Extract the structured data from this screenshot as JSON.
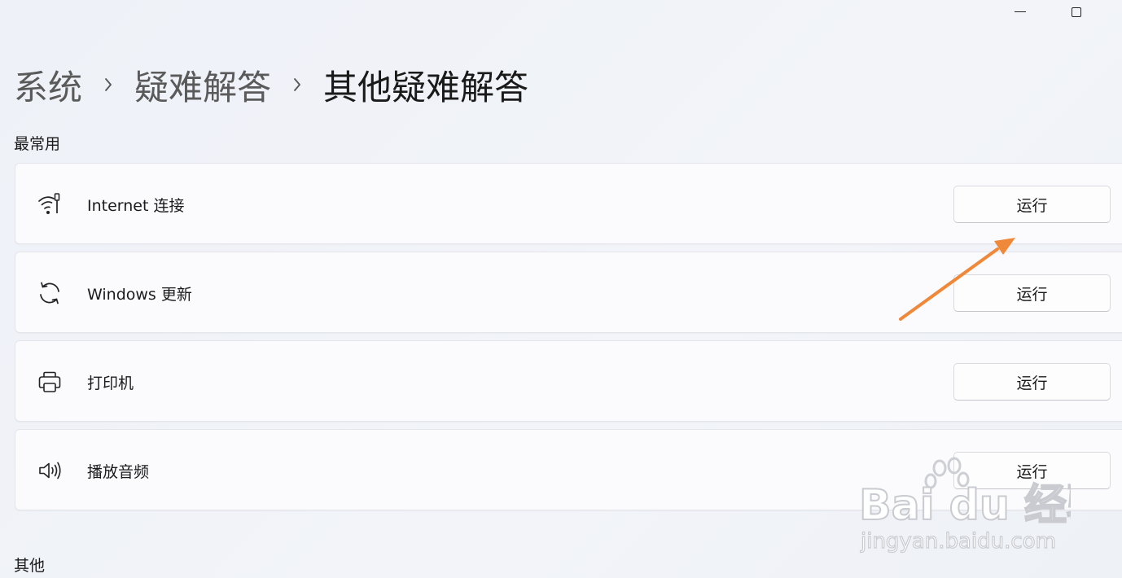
{
  "window": {
    "minimize_icon": "minimize-icon",
    "maximize_icon": "maximize-icon"
  },
  "breadcrumb": {
    "items": [
      "系统",
      "疑难解答",
      "其他疑难解答"
    ],
    "separator_icon": "chevron-right-icon"
  },
  "sections": {
    "most_used": "最常用",
    "other": "其他"
  },
  "troubleshooters": [
    {
      "label": "Internet 连接",
      "icon": "wifi-icon",
      "button": "运行"
    },
    {
      "label": "Windows 更新",
      "icon": "sync-icon",
      "button": "运行"
    },
    {
      "label": "打印机",
      "icon": "printer-icon",
      "button": "运行"
    },
    {
      "label": "播放音频",
      "icon": "speaker-icon",
      "button": "运行"
    }
  ],
  "annotation": {
    "arrow_color": "#f0883a"
  },
  "watermark": {
    "brand": "Bai du 经验",
    "url": "jingyan.baidu.com"
  }
}
